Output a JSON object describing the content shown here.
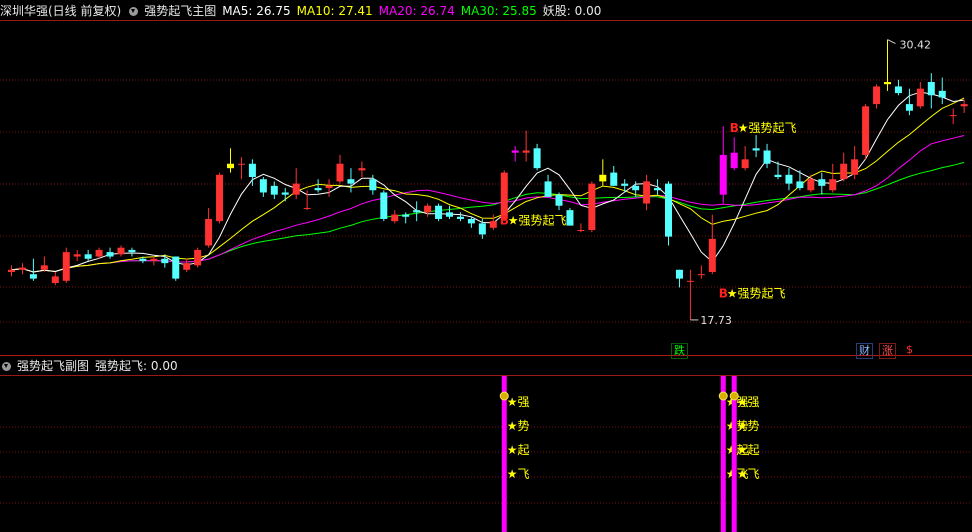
{
  "header_main": {
    "stock": "深圳华强(日线 前复权)",
    "indicator": "强势起飞主图",
    "ma5": "MA5: 26.75",
    "ma10": "MA10: 27.41",
    "ma20": "MA20: 26.74",
    "ma30": "MA30: 25.85",
    "yao": "妖股: 0.00"
  },
  "header_sub": {
    "indicator": "强势起飞副图",
    "value": "强势起飞: 0.00"
  },
  "price_marks": {
    "high": "30.42",
    "low": "17.73"
  },
  "signals": {
    "b": "B",
    "label": "★强势起飞",
    "chars": [
      "★强",
      "★势",
      "★起",
      "★飞"
    ]
  },
  "tags": {
    "die": "跌",
    "cai": "财",
    "zhang": "涨",
    "money": "$"
  },
  "colors": {
    "up": "#ff3232",
    "down": "#54ffff",
    "yellow": "#ffff00",
    "magenta": "#ff00ff",
    "ma5": "#ffffff",
    "ma10": "#ffff00",
    "ma20": "#ff00ff",
    "ma30": "#00ff00",
    "grid": "#7a1010"
  },
  "chart_data": {
    "type": "candlestick",
    "price_range": [
      17.73,
      30.42
    ],
    "candles": [
      [
        19.9,
        20.0,
        19.7,
        20.2
      ],
      [
        20.0,
        20.1,
        19.8,
        20.3
      ],
      [
        19.8,
        19.6,
        19.5,
        20.5
      ],
      [
        20.0,
        20.2,
        19.9,
        20.6
      ],
      [
        19.4,
        19.7,
        19.3,
        19.9
      ],
      [
        19.5,
        20.8,
        19.4,
        21.0
      ],
      [
        20.6,
        20.7,
        20.4,
        20.9
      ],
      [
        20.7,
        20.5,
        20.4,
        20.9
      ],
      [
        20.6,
        20.9,
        20.5,
        21.0
      ],
      [
        20.8,
        20.6,
        20.5,
        21.0
      ],
      [
        20.7,
        21.0,
        20.6,
        21.1
      ],
      [
        20.9,
        20.8,
        20.6,
        21.0
      ],
      [
        20.5,
        20.4,
        20.3,
        20.6
      ],
      [
        20.4,
        20.5,
        20.2,
        20.6
      ],
      [
        20.5,
        20.3,
        20.1,
        20.7
      ],
      [
        20.6,
        19.6,
        19.5,
        20.6
      ],
      [
        20.0,
        20.3,
        19.9,
        20.5
      ],
      [
        20.2,
        20.9,
        20.1,
        21.0
      ],
      [
        21.1,
        22.3,
        21.0,
        22.8
      ],
      [
        22.2,
        24.3,
        22.1,
        24.4
      ],
      [
        24.6,
        24.8,
        24.4,
        25.5
      ],
      [
        24.8,
        24.8,
        24.1,
        25.1
      ],
      [
        24.8,
        24.2,
        23.8,
        25.0
      ],
      [
        24.1,
        23.5,
        23.3,
        24.2
      ],
      [
        23.8,
        23.4,
        23.2,
        24.0
      ],
      [
        23.5,
        23.4,
        23.1,
        23.7
      ],
      [
        23.4,
        23.9,
        23.2,
        24.6
      ],
      [
        22.8,
        22.8,
        22.7,
        23.6
      ],
      [
        23.7,
        23.6,
        23.5,
        24.1
      ],
      [
        23.7,
        23.8,
        23.3,
        24.1
      ],
      [
        24.0,
        24.8,
        23.9,
        25.2
      ],
      [
        24.1,
        23.9,
        23.5,
        24.6
      ],
      [
        24.5,
        24.6,
        24.2,
        24.9
      ],
      [
        24.1,
        23.6,
        23.4,
        24.3
      ],
      [
        23.5,
        22.3,
        22.2,
        23.6
      ],
      [
        22.2,
        22.5,
        22.1,
        22.7
      ],
      [
        22.5,
        22.4,
        22.1,
        22.6
      ],
      [
        22.7,
        22.6,
        22.2,
        23.1
      ],
      [
        22.6,
        22.9,
        22.4,
        23.0
      ],
      [
        22.9,
        22.3,
        22.2,
        23.0
      ],
      [
        22.6,
        22.4,
        22.3,
        22.9
      ],
      [
        22.4,
        22.3,
        22.2,
        22.6
      ],
      [
        22.3,
        22.1,
        21.9,
        22.4
      ],
      [
        22.1,
        21.6,
        21.4,
        22.3
      ],
      [
        21.9,
        22.2,
        21.8,
        22.5
      ],
      [
        22.3,
        24.4,
        22.2,
        24.5
      ],
      [
        25.4,
        25.3,
        24.9,
        25.6
      ],
      [
        25.3,
        25.4,
        24.9,
        26.3
      ],
      [
        25.5,
        24.6,
        24.5,
        25.7
      ],
      [
        24.0,
        23.3,
        23.3,
        24.3
      ],
      [
        23.4,
        22.9,
        22.7,
        23.5
      ],
      [
        22.7,
        22.0,
        22.0,
        22.8
      ],
      [
        21.8,
        21.8,
        21.7,
        22.1
      ],
      [
        21.8,
        23.9,
        21.7,
        24.0
      ],
      [
        24.0,
        24.3,
        23.8,
        25.0
      ],
      [
        24.4,
        23.8,
        23.8,
        24.7
      ],
      [
        23.9,
        23.8,
        23.5,
        24.1
      ],
      [
        23.8,
        23.6,
        23.3,
        24.0
      ],
      [
        23.0,
        24.0,
        22.7,
        24.3
      ],
      [
        23.7,
        23.6,
        23.4,
        24.1
      ],
      [
        23.9,
        21.5,
        21.1,
        24.0
      ],
      [
        20.0,
        19.6,
        19.2,
        20.0
      ],
      [
        19.5,
        19.5,
        17.73,
        20.0
      ],
      [
        19.8,
        19.8,
        19.6,
        20.2
      ],
      [
        19.9,
        21.4,
        19.8,
        22.5
      ],
      [
        23.4,
        25.2,
        23.0,
        26.5
      ],
      [
        25.3,
        24.6,
        24.5,
        26.0
      ],
      [
        24.6,
        25.0,
        24.5,
        25.6
      ],
      [
        25.5,
        25.4,
        25.1,
        26.1
      ],
      [
        25.4,
        24.8,
        24.6,
        25.7
      ],
      [
        24.3,
        24.2,
        24.1,
        24.9
      ],
      [
        24.3,
        23.9,
        23.6,
        24.6
      ],
      [
        24.0,
        23.7,
        23.6,
        24.5
      ],
      [
        23.6,
        24.1,
        23.5,
        24.3
      ],
      [
        24.1,
        23.8,
        23.4,
        24.4
      ],
      [
        23.6,
        24.1,
        23.5,
        24.8
      ],
      [
        24.1,
        24.8,
        24.0,
        25.3
      ],
      [
        24.3,
        25.0,
        24.1,
        25.6
      ],
      [
        25.2,
        27.4,
        25.0,
        27.5
      ],
      [
        27.5,
        28.3,
        27.3,
        28.4
      ],
      [
        28.4,
        28.5,
        28.1,
        30.42
      ],
      [
        28.3,
        28.0,
        27.9,
        28.6
      ],
      [
        27.5,
        27.2,
        27.0,
        28.2
      ],
      [
        27.4,
        28.2,
        27.3,
        28.5
      ],
      [
        28.5,
        27.9,
        27.3,
        28.9
      ],
      [
        28.1,
        27.8,
        27.5,
        28.7
      ],
      [
        27.0,
        27.0,
        26.6,
        27.3
      ],
      [
        27.4,
        27.5,
        27.1,
        27.7
      ]
    ]
  }
}
